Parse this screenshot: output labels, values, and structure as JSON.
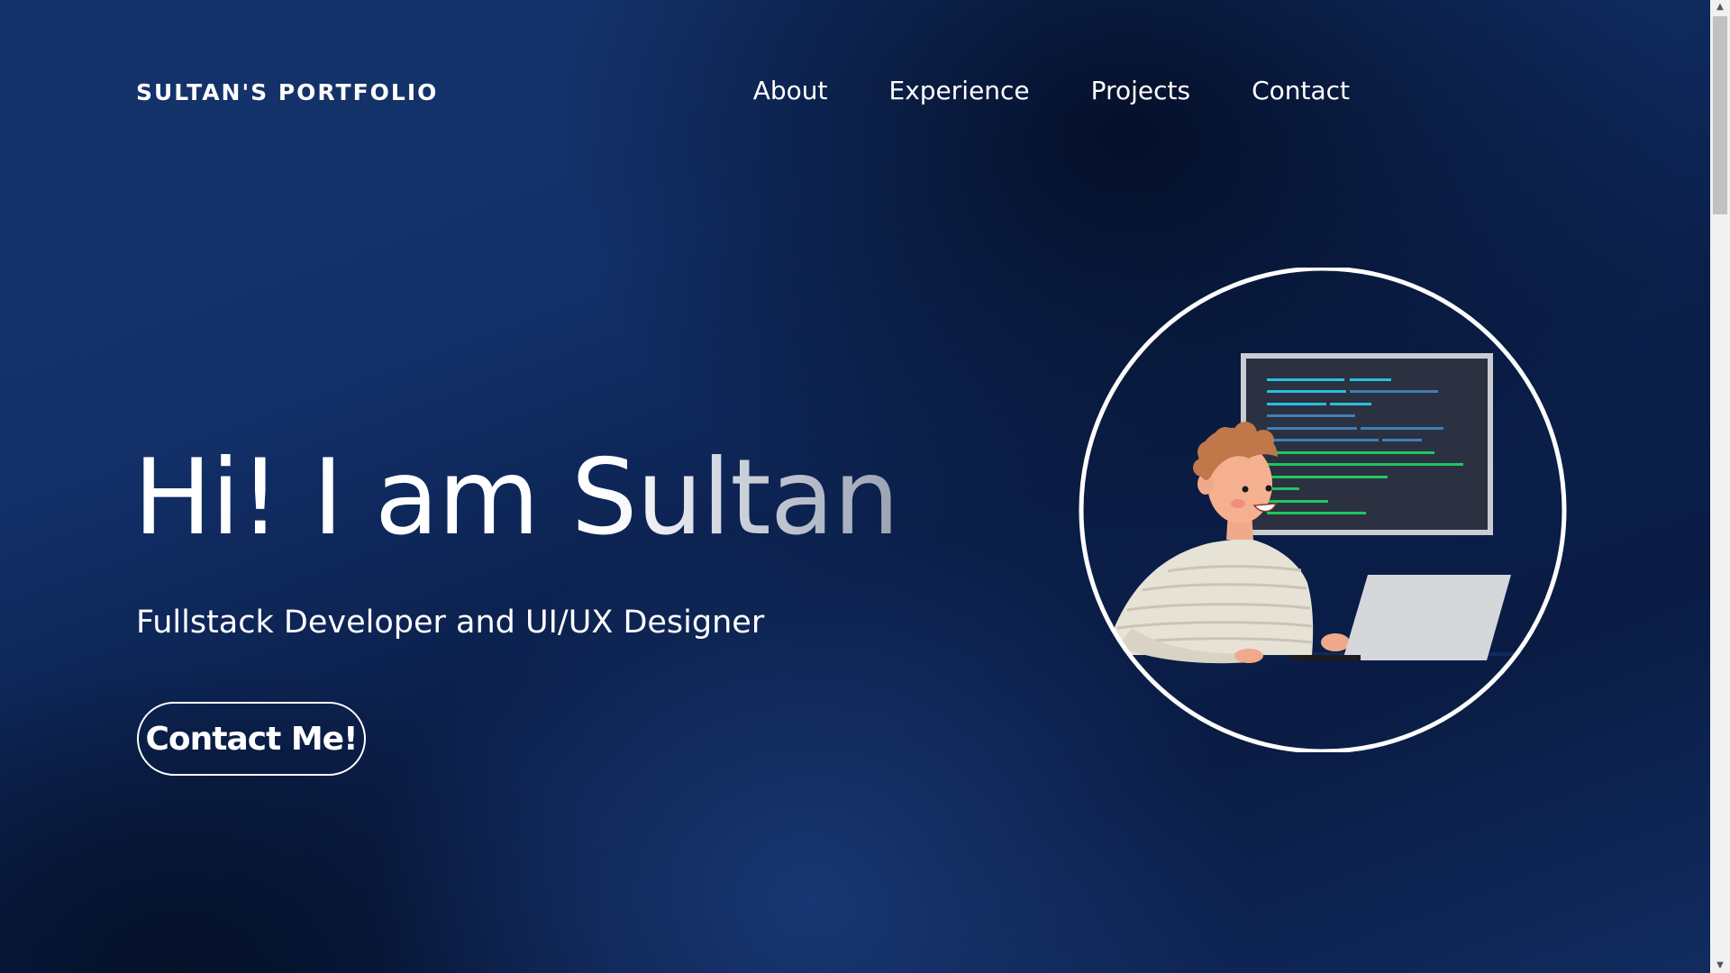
{
  "header": {
    "brand": "SULTAN'S PORTFOLIO",
    "nav": [
      {
        "label": "About"
      },
      {
        "label": "Experience"
      },
      {
        "label": "Projects"
      },
      {
        "label": "Contact"
      }
    ]
  },
  "hero": {
    "title": "Hi! I am Sultan",
    "subtitle": "Fullstack Developer and UI/UX Designer",
    "cta_label": "Contact Me!"
  },
  "illustration": {
    "icon": "developer-at-laptop-illustration"
  },
  "scrollbar": {
    "up_glyph": "▲",
    "down_glyph": "▼"
  },
  "colors": {
    "background_dark": "#0a1c44",
    "background_light": "#15336a",
    "text": "#ffffff",
    "code_cyan": "#27c0e0",
    "code_blue": "#3f7fb8",
    "code_green": "#22c55e"
  }
}
